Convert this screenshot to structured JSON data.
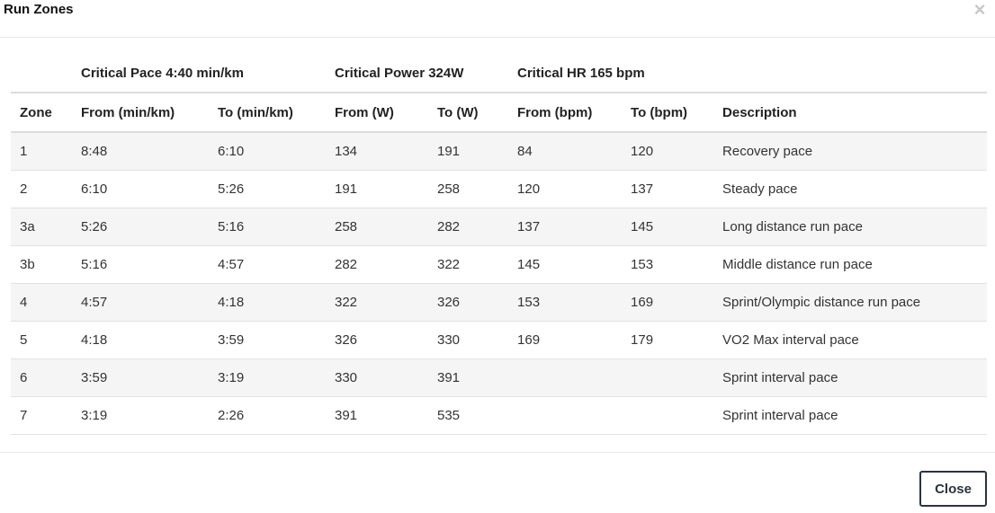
{
  "dialog": {
    "title": "Run Zones",
    "close_icon_glyph": "×",
    "close_button_label": "Close"
  },
  "groups": {
    "pace": "Critical Pace 4:40 min/km",
    "power": "Critical Power 324W",
    "hr": "Critical HR 165 bpm"
  },
  "columns": {
    "zone": "Zone",
    "from_pace": "From (min/km)",
    "to_pace": "To (min/km)",
    "from_w": "From (W)",
    "to_w": "To (W)",
    "from_bpm": "From (bpm)",
    "to_bpm": "To (bpm)",
    "description": "Description"
  },
  "rows": [
    {
      "zone": "1",
      "from_pace": "8:48",
      "to_pace": "6:10",
      "from_w": "134",
      "to_w": "191",
      "from_bpm": "84",
      "to_bpm": "120",
      "description": "Recovery pace"
    },
    {
      "zone": "2",
      "from_pace": "6:10",
      "to_pace": "5:26",
      "from_w": "191",
      "to_w": "258",
      "from_bpm": "120",
      "to_bpm": "137",
      "description": "Steady pace"
    },
    {
      "zone": "3a",
      "from_pace": "5:26",
      "to_pace": "5:16",
      "from_w": "258",
      "to_w": "282",
      "from_bpm": "137",
      "to_bpm": "145",
      "description": "Long distance run pace"
    },
    {
      "zone": "3b",
      "from_pace": "5:16",
      "to_pace": "4:57",
      "from_w": "282",
      "to_w": "322",
      "from_bpm": "145",
      "to_bpm": "153",
      "description": "Middle distance run pace"
    },
    {
      "zone": "4",
      "from_pace": "4:57",
      "to_pace": "4:18",
      "from_w": "322",
      "to_w": "326",
      "from_bpm": "153",
      "to_bpm": "169",
      "description": "Sprint/Olympic distance run pace"
    },
    {
      "zone": "5",
      "from_pace": "4:18",
      "to_pace": "3:59",
      "from_w": "326",
      "to_w": "330",
      "from_bpm": "169",
      "to_bpm": "179",
      "description": "VO2 Max interval pace"
    },
    {
      "zone": "6",
      "from_pace": "3:59",
      "to_pace": "3:19",
      "from_w": "330",
      "to_w": "391",
      "from_bpm": "",
      "to_bpm": "",
      "description": "Sprint interval pace"
    },
    {
      "zone": "7",
      "from_pace": "3:19",
      "to_pace": "2:26",
      "from_w": "391",
      "to_w": "535",
      "from_bpm": "",
      "to_bpm": "",
      "description": "Sprint interval pace"
    }
  ],
  "icons": {
    "close": "close-icon"
  },
  "colors": {
    "button_border": "#2a3340",
    "stripe": "#f5f5f5",
    "divider": "#dcdcdc"
  }
}
